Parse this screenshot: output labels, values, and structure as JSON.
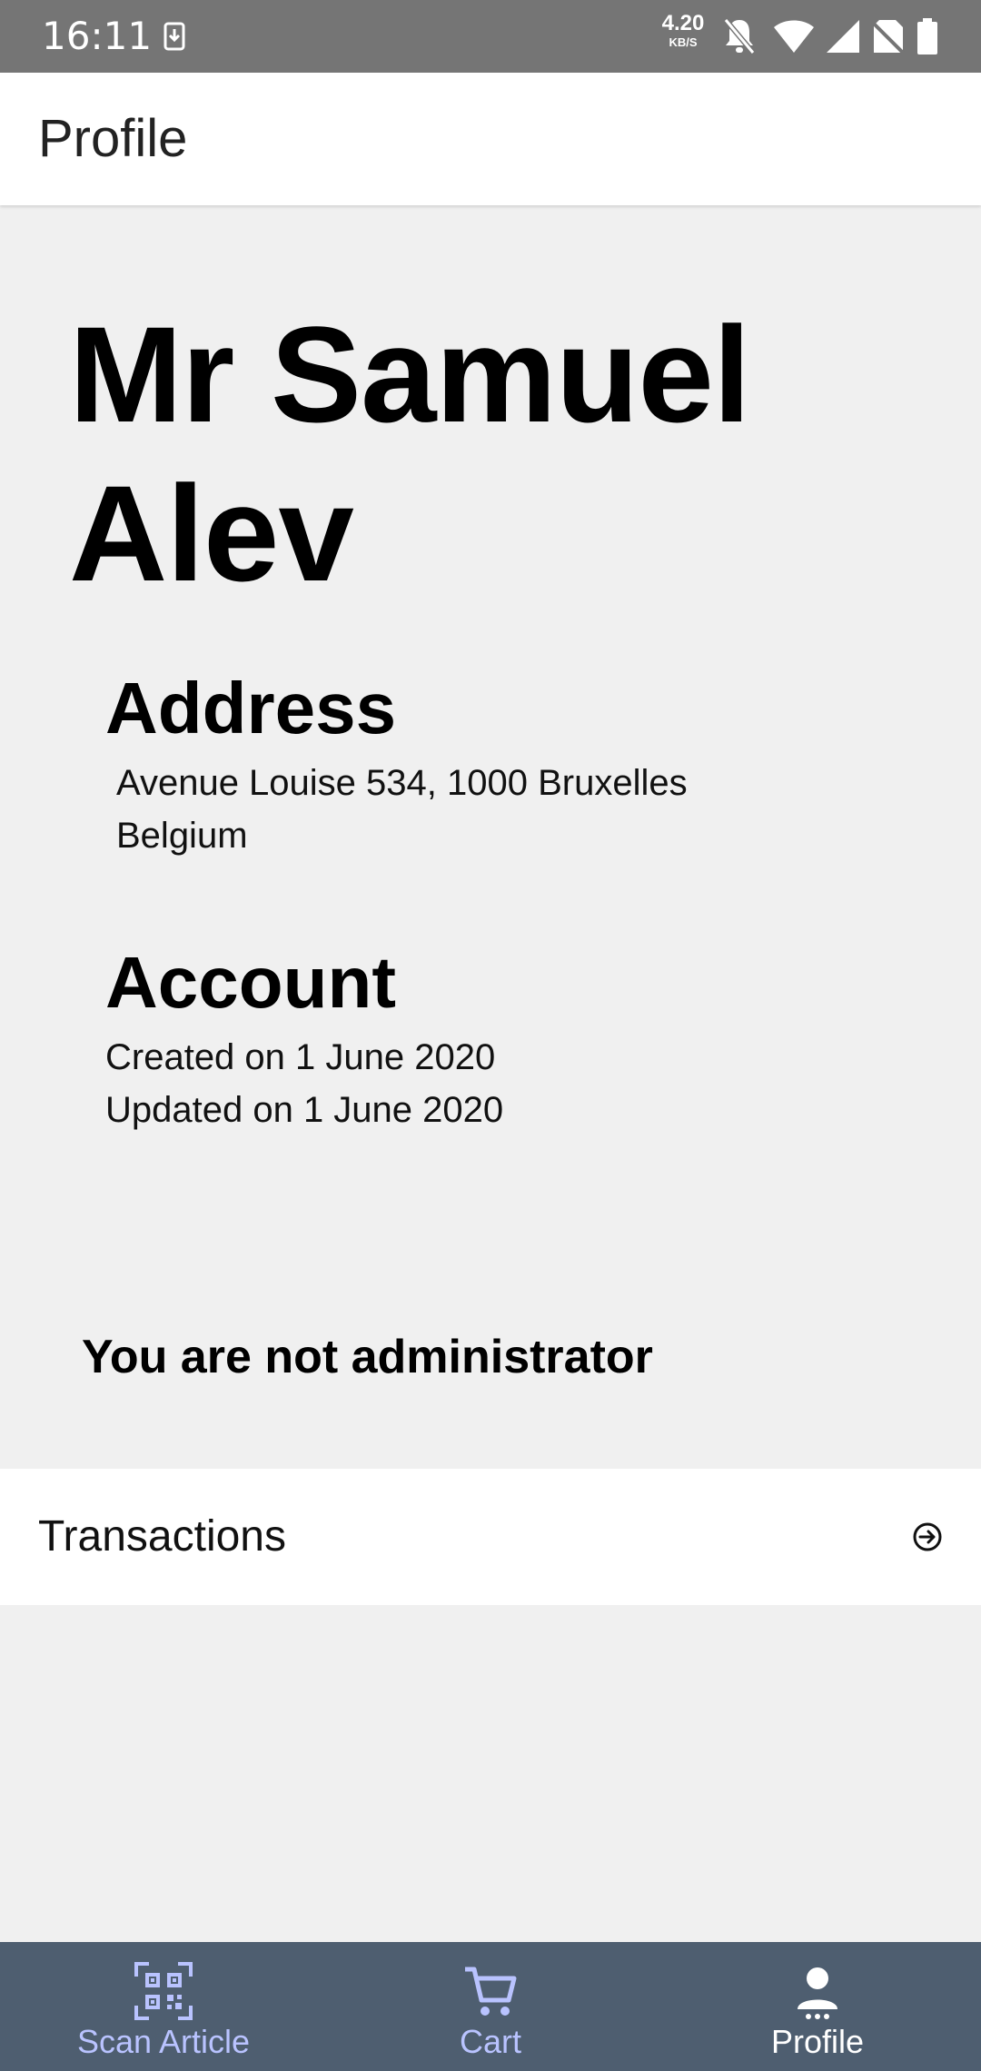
{
  "status_bar": {
    "time": "16:11",
    "network_speed": "4.20",
    "network_speed_unit": "KB/S",
    "icons": [
      "download-icon",
      "bell-off-icon",
      "wifi-icon",
      "signal-icon",
      "no-sim-icon",
      "battery-icon"
    ]
  },
  "app_bar": {
    "title": "Profile"
  },
  "profile": {
    "name": "Mr Samuel Alev",
    "address_heading": "Address",
    "address_line1": "Avenue Louise 534, 1000 Bruxelles",
    "address_line2": "Belgium",
    "account_heading": "Account",
    "created": "Created on 1 June 2020",
    "updated": "Updated on 1 June 2020",
    "admin_status": "You are not administrator"
  },
  "transactions": {
    "label": "Transactions",
    "icon": "arrow-right-circle-icon"
  },
  "bottom_nav": {
    "items": [
      {
        "label": "Scan Article",
        "icon": "qr-code-icon"
      },
      {
        "label": "Cart",
        "icon": "cart-icon"
      },
      {
        "label": "Profile",
        "icon": "person-icon"
      }
    ],
    "active_index": 2,
    "background": "#4e5e70",
    "active_color": "#ffffff",
    "inactive_color": "#b9c3ff"
  },
  "colors": {
    "status_bar": "#757575",
    "page_background": "#f0f0f0",
    "surface": "#ffffff"
  }
}
